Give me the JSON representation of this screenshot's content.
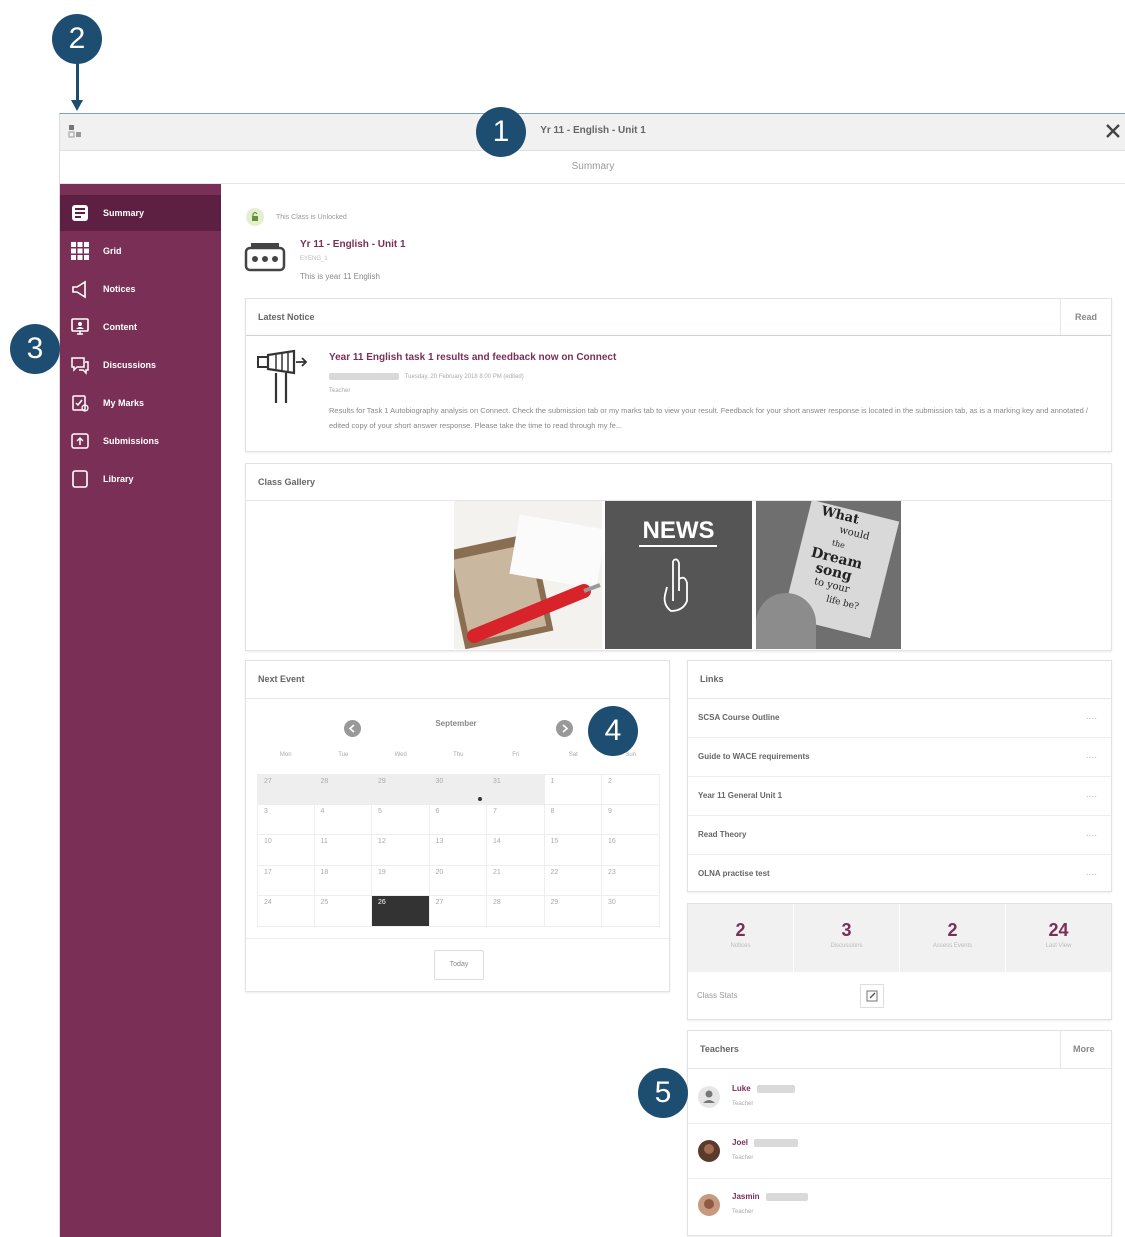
{
  "callouts": [
    "1",
    "2",
    "3",
    "4",
    "5"
  ],
  "window": {
    "title": "Yr 11 - English - Unit 1",
    "subtitle": "Summary",
    "close_icon": "close-icon"
  },
  "sidebar": {
    "items": [
      {
        "label": "Summary",
        "icon": "summary-icon",
        "active": true
      },
      {
        "label": "Grid",
        "icon": "grid-icon"
      },
      {
        "label": "Notices",
        "icon": "megaphone-icon"
      },
      {
        "label": "Content",
        "icon": "presentation-icon"
      },
      {
        "label": "Discussions",
        "icon": "speech-bubble-icon"
      },
      {
        "label": "My Marks",
        "icon": "marks-icon"
      },
      {
        "label": "Submissions",
        "icon": "upload-icon"
      },
      {
        "label": "Library",
        "icon": "library-icon"
      }
    ]
  },
  "class_info": {
    "unlocked_text": "This Class is Unlocked",
    "title": "Yr 11 - English - Unit 1",
    "code": "EYENG_1",
    "description": "This is year 11 English"
  },
  "latest_notice": {
    "header": "Latest Notice",
    "read_label": "Read",
    "title": "Year 11 English task 1 results and feedback now on Connect",
    "meta": "Tuesday, 20 February 2018 8:00 PM (edited)",
    "role": "Teacher",
    "body": "Results for Task 1 Autobiography analysis on Connect. Check the submission tab or my marks tab to view your result. Feedback for your short answer response is located in the submission tab, as is a marking key and annotated / edited copy of your short answer response. Please take the time to read through my fe..."
  },
  "gallery": {
    "header": "Class Gallery",
    "images": [
      "photo-pen-image",
      "news-image",
      "dream-song-image"
    ],
    "news_text": "NEWS",
    "dream_text_lines": [
      "What",
      "would",
      "the",
      "Dream",
      "song",
      "to your",
      "life be?"
    ]
  },
  "next_event": {
    "header": "Next Event",
    "month": "September",
    "weekdays": [
      "Mon",
      "Tue",
      "Wed",
      "Thu",
      "Fri",
      "Sat",
      "Sun"
    ],
    "weeks": [
      [
        "27",
        "28",
        "29",
        "30",
        "31",
        "1",
        "2"
      ],
      [
        "3",
        "4",
        "5",
        "6",
        "7",
        "8",
        "9"
      ],
      [
        "10",
        "11",
        "12",
        "13",
        "14",
        "15",
        "16"
      ],
      [
        "17",
        "18",
        "19",
        "20",
        "21",
        "22",
        "23"
      ],
      [
        "24",
        "25",
        "26",
        "27",
        "28",
        "29",
        "30"
      ]
    ],
    "today_label": "Today"
  },
  "links": {
    "header": "Links",
    "items": [
      "SCSA Course Outline",
      "Guide to WACE requirements",
      "Year 11 General Unit 1",
      "Read Theory",
      "OLNA practise test"
    ],
    "more_glyph": "...."
  },
  "stats": {
    "items": [
      {
        "value": "2",
        "label": "Notices"
      },
      {
        "value": "3",
        "label": "Discussions"
      },
      {
        "value": "2",
        "label": "Assess Events"
      },
      {
        "value": "24",
        "label": "Last View"
      }
    ],
    "footer_label": "Class Stats"
  },
  "teachers": {
    "header": "Teachers",
    "more_label": "More",
    "items": [
      {
        "name": "Luke",
        "role": "Teacher"
      },
      {
        "name": "Joel",
        "role": "Teacher"
      },
      {
        "name": "Jasmin",
        "role": "Teacher"
      }
    ]
  },
  "colors": {
    "brand": "#7a2f57",
    "brand_dark": "#5e2042",
    "callout": "#1d4e72"
  }
}
